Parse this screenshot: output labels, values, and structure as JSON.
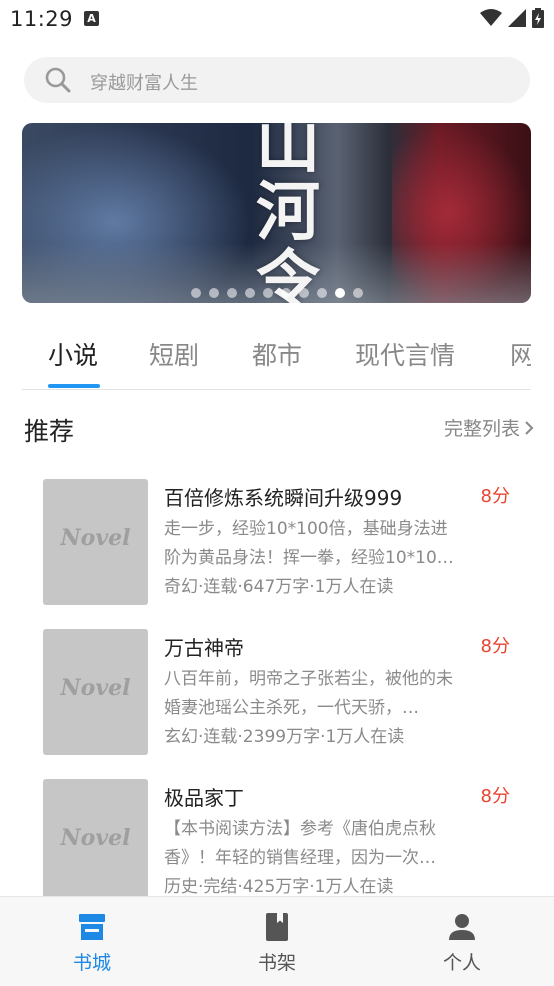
{
  "status_bar": {
    "time": "11:29",
    "notification_letter": "A"
  },
  "search": {
    "placeholder": "穿越财富人生"
  },
  "banner": {
    "title": "山河令",
    "slides": 10,
    "active_slide": 9
  },
  "tabs": [
    {
      "label": "小说",
      "active": true
    },
    {
      "label": "短剧",
      "active": false
    },
    {
      "label": "都市",
      "active": false
    },
    {
      "label": "现代言情",
      "active": false
    },
    {
      "label": "网",
      "active": false
    }
  ],
  "section": {
    "title": "推荐",
    "more_label": "完整列表"
  },
  "books": [
    {
      "cover_text": "Novel",
      "title": "百倍修炼系统瞬间升级999",
      "score": "8分",
      "desc": "走一步，经验10*100倍，基础身法进阶为黄品身法！挥一拳，经验10*10…",
      "meta": "奇幻·连载·647万字·1万人在读"
    },
    {
      "cover_text": "Novel",
      "title": "万古神帝",
      "score": "8分",
      "desc": "八百年前，明帝之子张若尘，被他的未婚妻池瑶公主杀死，一代天骄，…",
      "meta": "玄幻·连载·2399万字·1万人在读"
    },
    {
      "cover_text": "Novel",
      "title": "极品家丁",
      "score": "8分",
      "desc": "【本书阅读方法】参考《唐伯虎点秋香》！年轻的销售经理，因为一次…",
      "meta": "历史·完结·425万字·1万人在读"
    }
  ],
  "bottom_nav": [
    {
      "label": "书城",
      "icon": "store-icon",
      "active": true
    },
    {
      "label": "书架",
      "icon": "bookshelf-icon",
      "active": false
    },
    {
      "label": "个人",
      "icon": "person-icon",
      "active": false
    }
  ],
  "colors": {
    "accent": "#2196f3",
    "score": "#e8432e",
    "nav_active": "#1e88e5"
  }
}
